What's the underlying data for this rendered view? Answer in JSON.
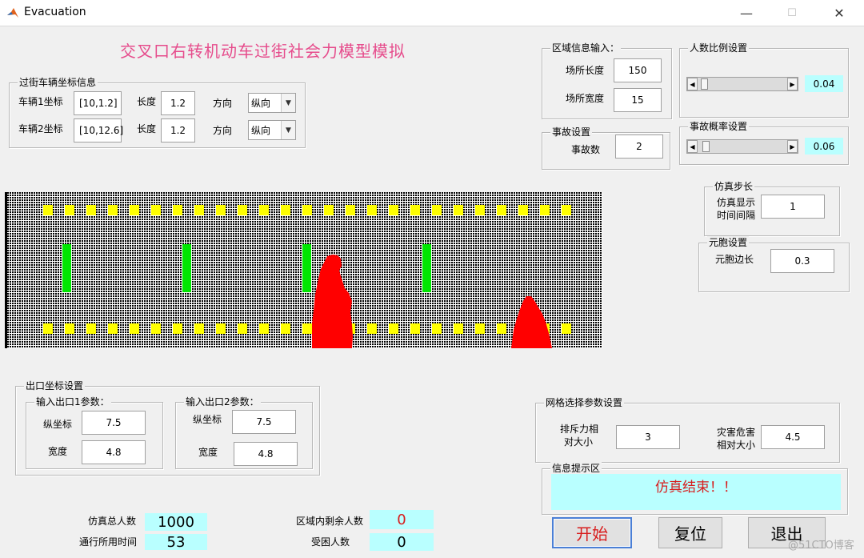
{
  "window": {
    "title": "Evacuation",
    "minimize": "—",
    "maximize": "☐",
    "close": "✕"
  },
  "heading": "交叉口右转机动车过街社会力模型模拟",
  "vehicle": {
    "group_title": "过街车辆坐标信息",
    "v1_label": "车辆1坐标",
    "v1_coord": "[10,1.2]",
    "v1_len_label": "长度",
    "v1_len": "1.2",
    "v1_dir_label": "方向",
    "v1_dir": "纵向",
    "v2_label": "车辆2坐标",
    "v2_coord": "[10,12.6]",
    "v2_len_label": "长度",
    "v2_len": "1.2",
    "v2_dir_label": "方向",
    "v2_dir": "纵向"
  },
  "area": {
    "group_title": "区域信息输入：",
    "length_label": "场所长度",
    "length": "150",
    "width_label": "场所宽度",
    "width": "15"
  },
  "ratio": {
    "group_title": "人数比例设置",
    "value": "0.04",
    "level": 0.04
  },
  "accident": {
    "group_title": "事故设置",
    "count_label": "事故数",
    "count": "2"
  },
  "accident_prob": {
    "group_title": "事故概率设置",
    "value": "0.06",
    "level": 0.06
  },
  "sim_step": {
    "group_title": "仿真步长",
    "label1": "仿真显示",
    "label2": "时间间隔",
    "value": "1"
  },
  "cell": {
    "group_title": "元胞设置",
    "label": "元胞边长",
    "value": "0.3"
  },
  "exit": {
    "group_title": "出口坐标设置",
    "e1": {
      "title": "输入出口1参数：",
      "y_label": "纵坐标",
      "y": "7.5",
      "w_label": "宽度",
      "w": "4.8"
    },
    "e2": {
      "title": "输入出口2参数：",
      "y_label": "纵坐标",
      "y": "7.5",
      "w_label": "宽度",
      "w": "4.8"
    }
  },
  "grid": {
    "group_title": "网格选择参数设置",
    "rep_label1": "排斥力相",
    "rep_label2": "对大小",
    "rep": "3",
    "haz_label1": "灾害危害",
    "haz_label2": "相对大小",
    "haz": "4.5"
  },
  "info": {
    "group_title": "信息提示区",
    "message": "仿真结束！！"
  },
  "stats": {
    "total_label": "仿真总人数",
    "total": "1000",
    "time_label": "通行所用时间",
    "time": "53",
    "remain_label": "区域内剩余人数",
    "remain": "0",
    "trapped_label": "受困人数",
    "trapped": "0"
  },
  "buttons": {
    "start": "开始",
    "reset": "复位",
    "exit": "退出"
  },
  "watermark": "@51CTO博客",
  "colors": {
    "heading": "#e64c8c",
    "vehicle": "#00e600",
    "marker": "#ffff00",
    "crowd": "#ff0000",
    "info_text": "#d81d1d",
    "cyan": "#b9ffff"
  }
}
